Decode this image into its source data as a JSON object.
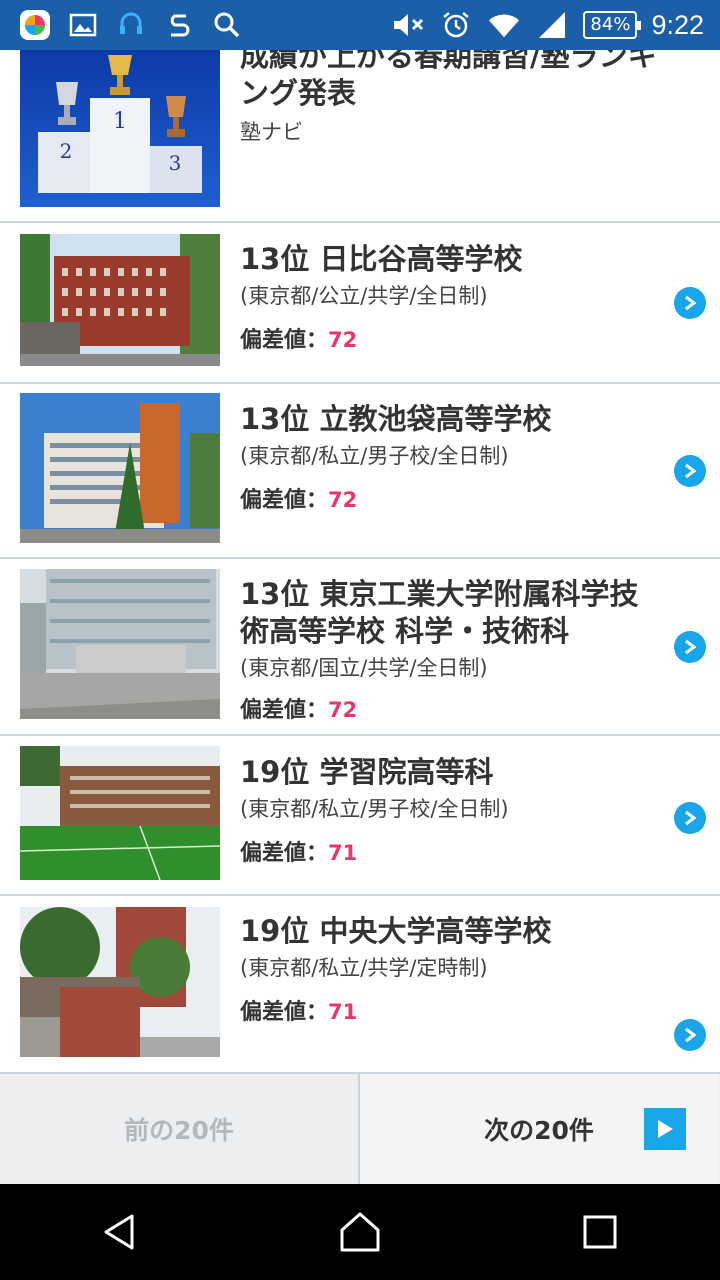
{
  "status_bar": {
    "battery": "84%",
    "time": "9:22"
  },
  "ranking_header": {
    "title": "成績が上がる春期講習/塾ランキング発表",
    "source": "塾ナビ"
  },
  "hensa_label": "偏差値：",
  "schools": [
    {
      "rank_title": "13位 日比谷高等学校",
      "info": "(東京都/公立/共学/全日制)",
      "score": "72"
    },
    {
      "rank_title": "13位 立教池袋高等学校",
      "info": "(東京都/私立/男子校/全日制)",
      "score": "72"
    },
    {
      "rank_title": "13位 東京工業大学附属科学技術高等学校 科学・技術科",
      "info": "(東京都/国立/共学/全日制)",
      "score": "72"
    },
    {
      "rank_title": "19位 学習院高等科",
      "info": "(東京都/私立/男子校/全日制)",
      "score": "71"
    },
    {
      "rank_title": "19位 中央大学高等学校",
      "info": "(東京都/私立/共学/定時制)",
      "score": "71"
    }
  ],
  "pager": {
    "prev_label": "前の20件",
    "next_label": "次の20件"
  },
  "colors": {
    "status_bar": "#1a5fa8",
    "accent": "#19a6e8",
    "score": "#e8386b"
  }
}
